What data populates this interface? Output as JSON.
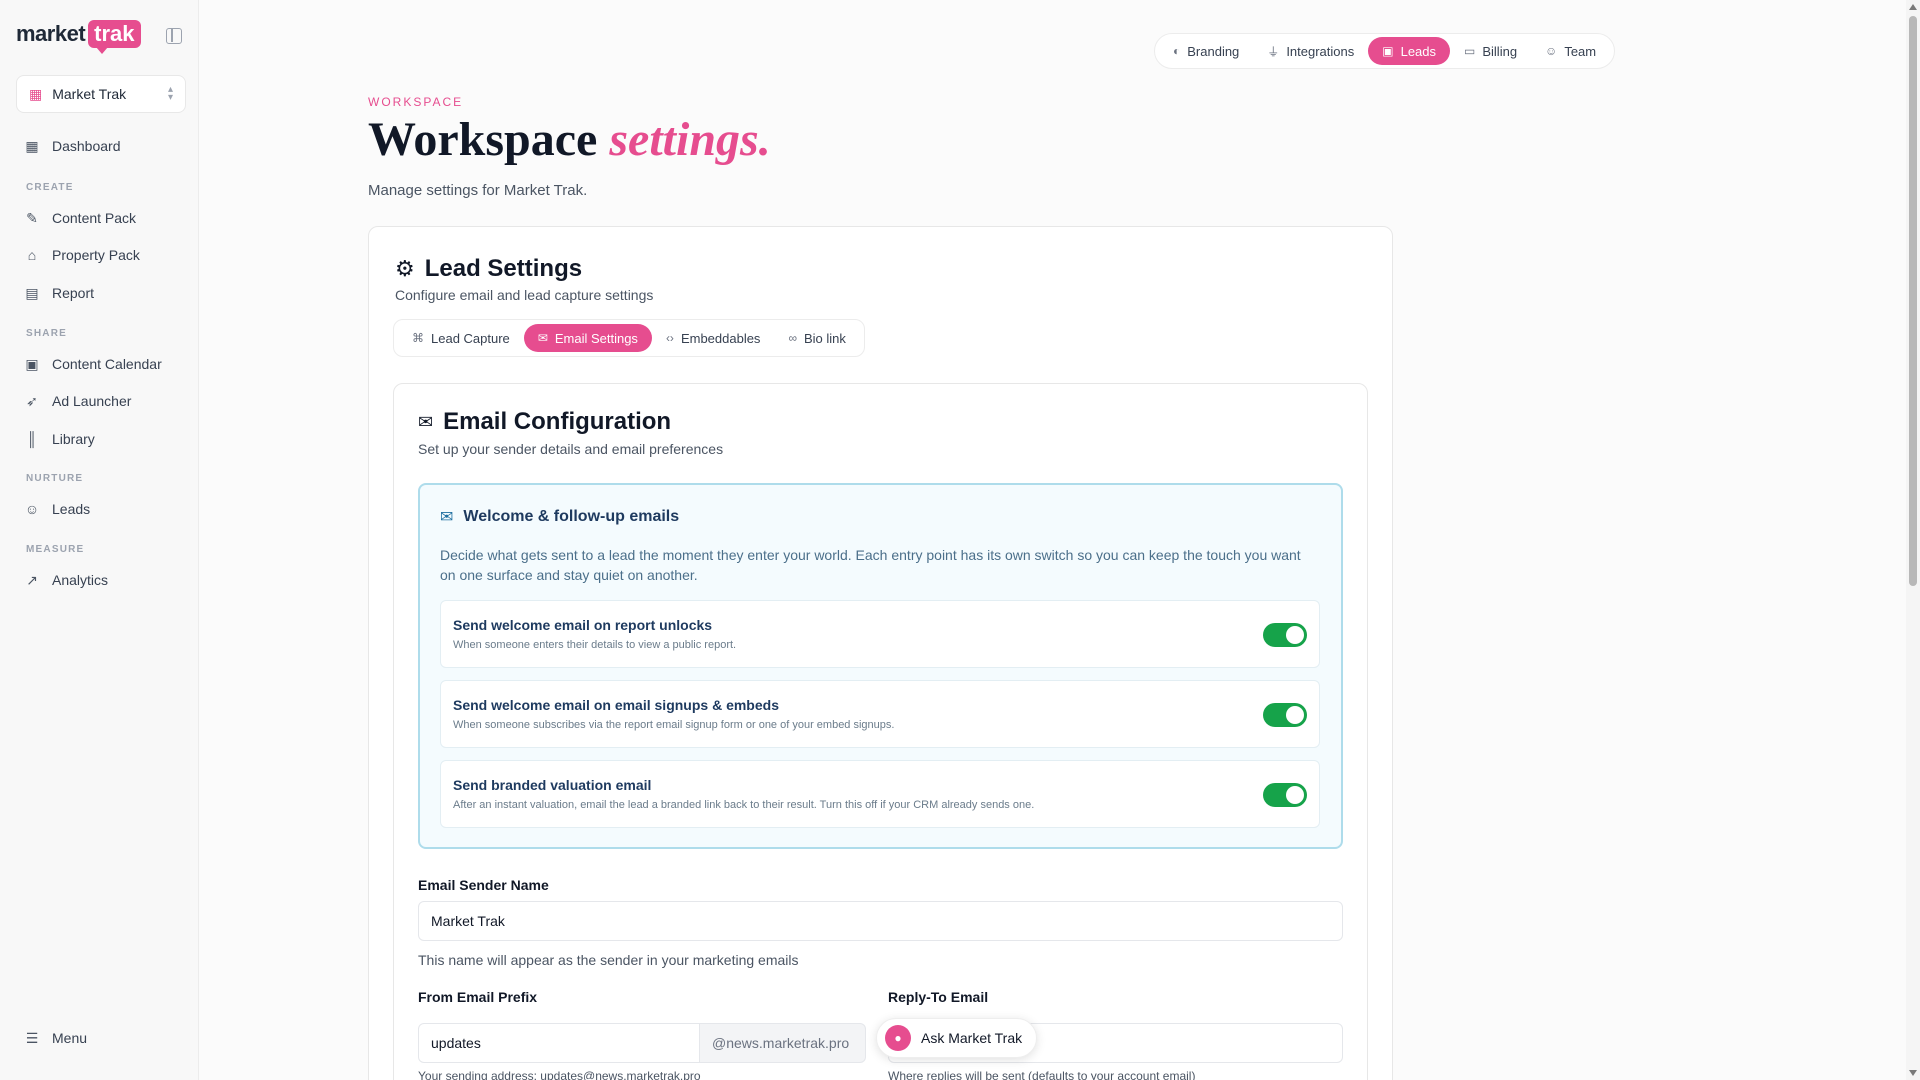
{
  "brand": {
    "name_left": "market",
    "name_right": "trak",
    "accent": "#e64d8f"
  },
  "workspace_select": {
    "name": "Market Trak",
    "icon": "building-icon"
  },
  "sidebar": {
    "dashboard": "Dashboard",
    "sections": {
      "create": "CREATE",
      "share": "SHARE",
      "nurture": "NURTURE",
      "measure": "MEASURE"
    },
    "items": {
      "content_pack": "Content Pack",
      "property_pack": "Property Pack",
      "report": "Report",
      "content_calendar": "Content Calendar",
      "ad_launcher": "Ad Launcher",
      "library": "Library",
      "leads": "Leads",
      "analytics": "Analytics"
    },
    "menu": "Menu"
  },
  "top_tabs": {
    "branding": "Branding",
    "integrations": "Integrations",
    "leads": "Leads",
    "billing": "Billing",
    "team": "Team",
    "active": "leads"
  },
  "header": {
    "eyebrow": "WORKSPACE",
    "title_main": "Workspace ",
    "title_accent": "settings.",
    "subtitle": "Manage settings for Market Trak."
  },
  "lead_settings": {
    "title": "Lead Settings",
    "subtitle": "Configure email and lead capture settings",
    "tabs": {
      "lead_capture": "Lead Capture",
      "email_settings": "Email Settings",
      "embeddables": "Embeddables",
      "bio_link": "Bio link",
      "active": "email_settings"
    }
  },
  "email_config": {
    "title": "Email Configuration",
    "subtitle": "Set up your sender details and email preferences",
    "welcome": {
      "title": "Welcome & follow-up emails",
      "description": "Decide what gets sent to a lead the moment they enter your world. Each entry point has its own switch so you can keep the touch you want on one surface and stay quiet on another.",
      "toggles": [
        {
          "title": "Send welcome email on report unlocks",
          "desc": "When someone enters their details to view a public report.",
          "on": true
        },
        {
          "title": "Send welcome email on email signups & embeds",
          "desc": "When someone subscribes via the report email signup form or one of your embed signups.",
          "on": true
        },
        {
          "title": "Send branded valuation email",
          "desc": "After an instant valuation, email the lead a branded link back to their result. Turn this off if your CRM already sends one.",
          "on": true
        }
      ]
    },
    "sender_name": {
      "label": "Email Sender Name",
      "value": "Market Trak",
      "help": "This name will appear as the sender in your marketing emails"
    },
    "from_prefix": {
      "label": "From Email Prefix",
      "value": "updates",
      "suffix": "@news.marketrak.pro",
      "help": "Your sending address: updates@news.marketrak.pro"
    },
    "reply_to": {
      "label": "Reply-To Email",
      "value": "",
      "help": "Where replies will be sent (defaults to your account email)"
    }
  },
  "ask": {
    "label": "Ask Market Trak"
  }
}
